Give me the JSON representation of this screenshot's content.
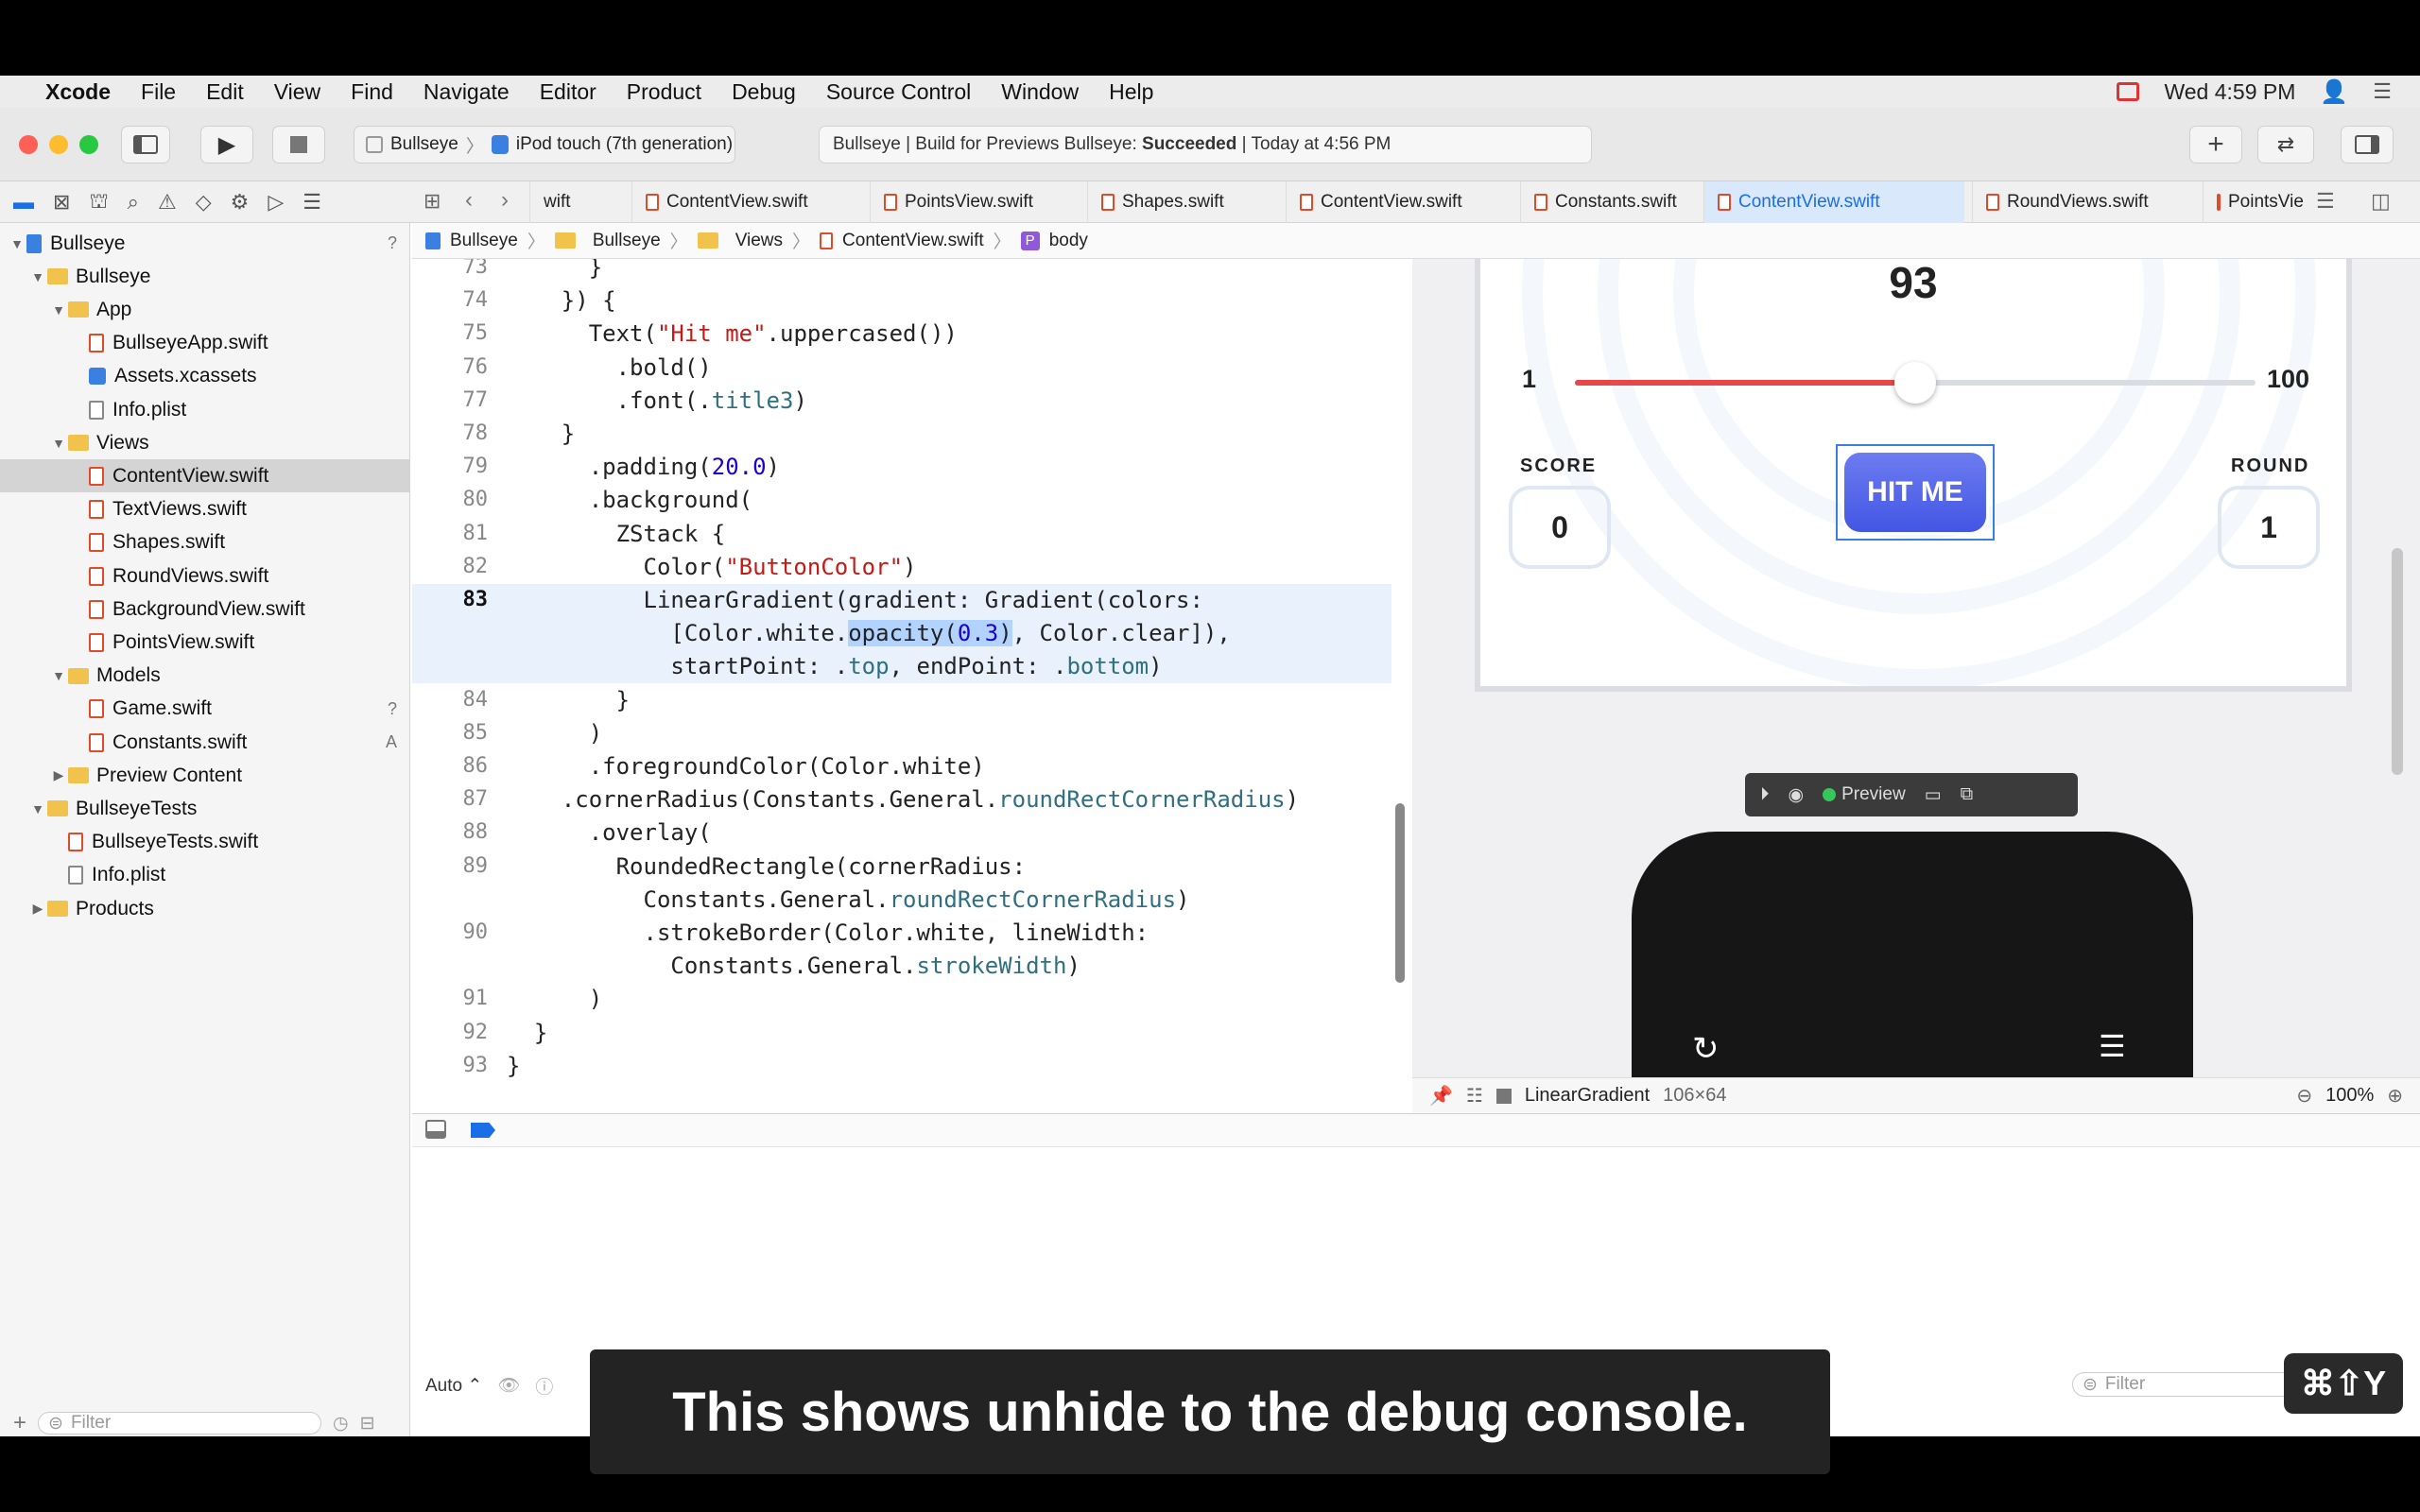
{
  "menubar": {
    "app": "Xcode",
    "items": [
      "File",
      "Edit",
      "View",
      "Find",
      "Navigate",
      "Editor",
      "Product",
      "Debug",
      "Source Control",
      "Window",
      "Help"
    ],
    "clock": "Wed 4:59 PM"
  },
  "toolbar": {
    "scheme": "Bullseye",
    "device": "iPod touch (7th generation)",
    "activity": "Bullseye | Build for Previews Bullseye: ",
    "activity_status": "Succeeded",
    "activity_time": " | Today at 4:56 PM"
  },
  "tabs": [
    "wift",
    "ContentView.swift",
    "PointsView.swift",
    "Shapes.swift",
    "ContentView.swift",
    "Constants.swift",
    "ContentView.swift",
    "RoundViews.swift",
    "PointsVie"
  ],
  "active_tab": 6,
  "jumpbar": [
    "Bullseye",
    "Bullseye",
    "Views",
    "ContentView.swift",
    "body"
  ],
  "navigator": [
    {
      "label": "Bullseye",
      "level": 0,
      "type": "project",
      "badge": "?"
    },
    {
      "label": "Bullseye",
      "level": 1,
      "type": "folder"
    },
    {
      "label": "App",
      "level": 2,
      "type": "folder"
    },
    {
      "label": "BullseyeApp.swift",
      "level": 3,
      "type": "file"
    },
    {
      "label": "Assets.xcassets",
      "level": 3,
      "type": "assets"
    },
    {
      "label": "Info.plist",
      "level": 3,
      "type": "plist"
    },
    {
      "label": "Views",
      "level": 2,
      "type": "folder"
    },
    {
      "label": "ContentView.swift",
      "level": 3,
      "type": "file",
      "selected": true
    },
    {
      "label": "TextViews.swift",
      "level": 3,
      "type": "file"
    },
    {
      "label": "Shapes.swift",
      "level": 3,
      "type": "file"
    },
    {
      "label": "RoundViews.swift",
      "level": 3,
      "type": "file"
    },
    {
      "label": "BackgroundView.swift",
      "level": 3,
      "type": "file"
    },
    {
      "label": "PointsView.swift",
      "level": 3,
      "type": "file"
    },
    {
      "label": "Models",
      "level": 2,
      "type": "folder"
    },
    {
      "label": "Game.swift",
      "level": 3,
      "type": "file",
      "badge": "?"
    },
    {
      "label": "Constants.swift",
      "level": 3,
      "type": "file",
      "badge": "A"
    },
    {
      "label": "Preview Content",
      "level": 2,
      "type": "folder",
      "collapsed": true
    },
    {
      "label": "BullseyeTests",
      "level": 1,
      "type": "folder"
    },
    {
      "label": "BullseyeTests.swift",
      "level": 2,
      "type": "file"
    },
    {
      "label": "Info.plist",
      "level": 2,
      "type": "plist"
    },
    {
      "label": "Products",
      "level": 1,
      "type": "folder",
      "collapsed": true
    }
  ],
  "filter_placeholder": "Filter",
  "code": [
    {
      "n": "73",
      "t": "      }"
    },
    {
      "n": "74",
      "t": "    }) {"
    },
    {
      "n": "75",
      "t": "      Text(\"Hit me\".uppercased())"
    },
    {
      "n": "76",
      "t": "        .bold()"
    },
    {
      "n": "77",
      "t": "        .font(.title3)"
    },
    {
      "n": "78",
      "t": "    }"
    },
    {
      "n": "79",
      "t": "      .padding(20.0)"
    },
    {
      "n": "80",
      "t": "      .background("
    },
    {
      "n": "81",
      "t": "        ZStack {"
    },
    {
      "n": "82",
      "t": "          Color(\"ButtonColor\")"
    },
    {
      "n": "83",
      "t": "          LinearGradient(gradient: Gradient(colors:"
    },
    {
      "n": "",
      "t": "            [Color.white.opacity(0.3), Color.clear]),"
    },
    {
      "n": "",
      "t": "            startPoint: .top, endPoint: .bottom)"
    },
    {
      "n": "84",
      "t": "        }"
    },
    {
      "n": "85",
      "t": "      )"
    },
    {
      "n": "86",
      "t": "      .foregroundColor(Color.white)"
    },
    {
      "n": "87",
      "t": "    .cornerRadius(Constants.General.roundRectCornerRadius)"
    },
    {
      "n": "88",
      "t": "      .overlay("
    },
    {
      "n": "89",
      "t": "        RoundedRectangle(cornerRadius:"
    },
    {
      "n": "",
      "t": "          Constants.General.roundRectCornerRadius)"
    },
    {
      "n": "90",
      "t": "          .strokeBorder(Color.white, lineWidth:"
    },
    {
      "n": "",
      "t": "            Constants.General.strokeWidth)"
    },
    {
      "n": "91",
      "t": "      )"
    },
    {
      "n": "92",
      "t": "  }"
    },
    {
      "n": "93",
      "t": "}"
    }
  ],
  "preview": {
    "target": "93",
    "slider_min": "1",
    "slider_max": "100",
    "slider_value": 0.5,
    "score_label": "SCORE",
    "score": "0",
    "button": "HIT ME",
    "round_label": "ROUND",
    "round": "1",
    "controls_label": "Preview"
  },
  "canvas_status": {
    "selection": "LinearGradient",
    "size": "106×64",
    "zoom": "100%"
  },
  "debug": {
    "mode": "Auto ⌃",
    "filter_placeholder": "Filter"
  },
  "caption": "This shows unhide to the debug console.",
  "shortcut": "⌘⇧Y",
  "colors": {
    "accent": "#1a6fe8",
    "button": "#4a5ce8",
    "slider": "#e8474a"
  }
}
